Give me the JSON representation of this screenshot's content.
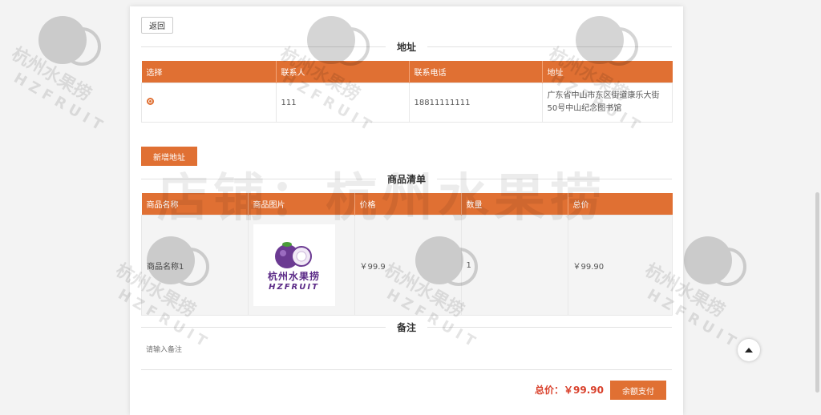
{
  "back_label": "返回",
  "address": {
    "title": "地址",
    "columns": [
      "选择",
      "联系人",
      "联系电话",
      "地址"
    ],
    "rows": [
      {
        "contact": "111",
        "phone": "18811111111",
        "addr": "广东省中山市东区街道康乐大街50号中山纪念图书馆"
      }
    ],
    "add_label": "新增地址"
  },
  "goods": {
    "title": "商品清单",
    "columns": [
      "商品名称",
      "商品图片",
      "价格",
      "数量",
      "总价"
    ],
    "rows": [
      {
        "name": "商品名称1",
        "price": "￥99.9",
        "qty": "1",
        "total": "￥99.90",
        "image_brand_cn": "杭州水果捞",
        "image_brand_en": "HZFRUIT"
      }
    ]
  },
  "remark": {
    "title": "备注",
    "placeholder": "请输入备注"
  },
  "summary": {
    "total": "总价：￥99.90",
    "pay_label": "余额支付"
  },
  "watermark": {
    "shop_text": "店铺：杭州水果捞",
    "brand_cn": "杭州水果捞",
    "brand_en": "HZFRUIT"
  },
  "colors": {
    "accent": "#e07033",
    "price_red": "#d9402b",
    "brand_purple": "#5b2a87"
  }
}
